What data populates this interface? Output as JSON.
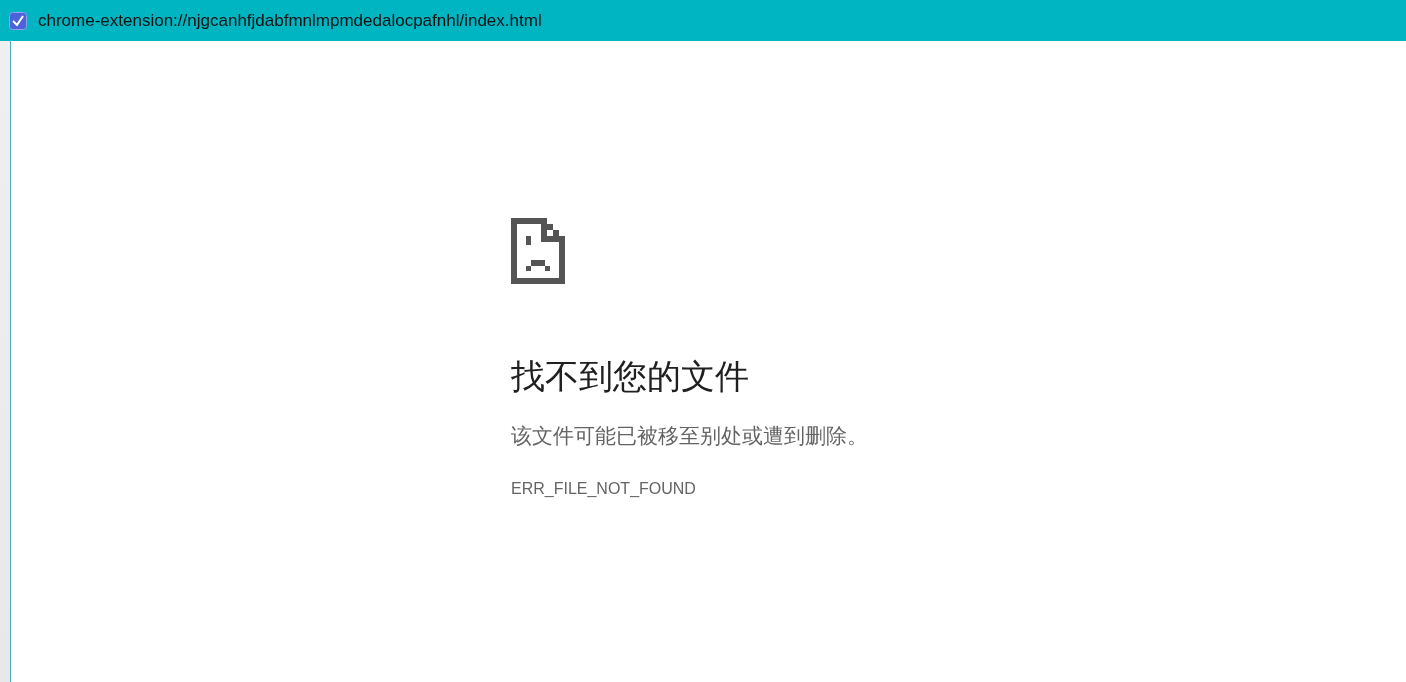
{
  "window": {
    "title": "chrome-extension://njgcanhfjdabfmnlmpmdedalocpafnhl/index.html"
  },
  "error": {
    "heading": "找不到您的文件",
    "message": "该文件可能已被移至别处或遭到删除。",
    "code": "ERR_FILE_NOT_FOUND"
  }
}
